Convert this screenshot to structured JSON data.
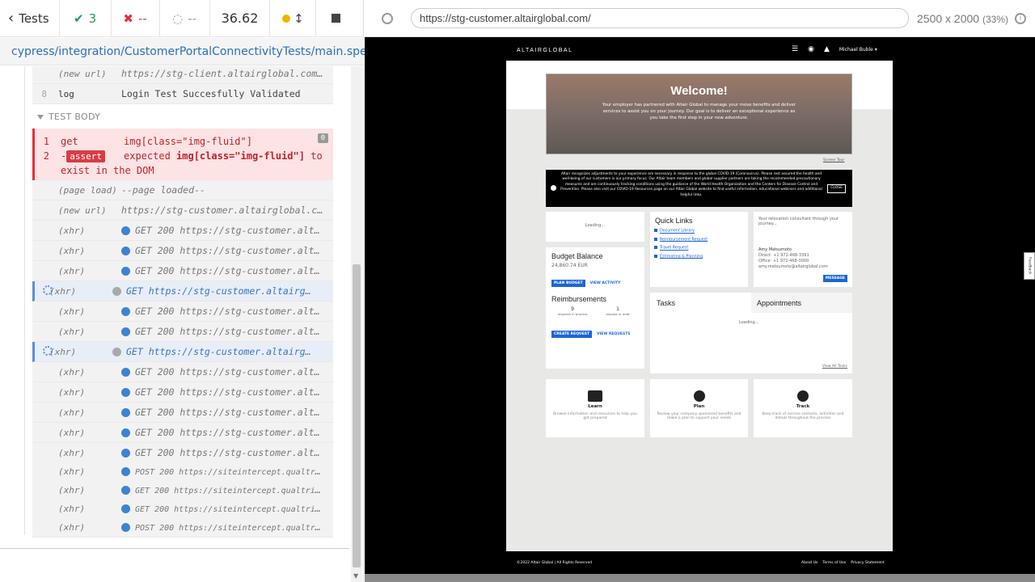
{
  "runner": {
    "tests_label": "Tests",
    "passed": "3",
    "failed": "--",
    "pending": "--",
    "duration": "36.62",
    "spec_path": "cypress/integration/CustomerPortalConnectivityTests/main.spec.js"
  },
  "reporter": {
    "pre_rows": [
      {
        "num": "",
        "name": "(new url)",
        "msg": "https://stg-client.altairglobal.com/a…"
      },
      {
        "num": "8",
        "name": "log",
        "msg": "Login Test Succesfully Validated"
      }
    ],
    "test_body_label": "TEST BODY",
    "fail": {
      "cmd1_num": "1",
      "cmd1_name": "get",
      "cmd1_msg": "img[class=\"img-fluid\"]",
      "badge": "0",
      "cmd2_num": "2",
      "cmd2_prefix": "-",
      "cmd2_name": "assert",
      "cmd2_msg_a": "expected",
      "cmd2_msg_b": "img[class=\"img-fluid\"]",
      "cmd2_msg_c": "to",
      "cmd2_msg_d": "exist in the DOM"
    },
    "rows": [
      {
        "name": "(page load)",
        "msg": "--page loaded--"
      },
      {
        "name": "(new url)",
        "msg": "https://stg-customer.altairglobal.com/"
      },
      {
        "name": "(xhr)",
        "msg": "GET 200 https://stg-customer.altai…"
      },
      {
        "name": "(xhr)",
        "msg": "GET 200 https://stg-customer.altai…"
      },
      {
        "name": "(xhr)",
        "msg": "GET 200 https://stg-customer.altai…"
      },
      {
        "name": "(xhr)",
        "msg": "GET https://stg-customer.altairglo…"
      },
      {
        "name": "(xhr)",
        "msg": "GET 200 https://stg-customer.altai…"
      },
      {
        "name": "(xhr)",
        "msg": "GET 200 https://stg-customer.altai…"
      },
      {
        "name": "(xhr)",
        "msg": "GET https://stg-customer.altairglo…"
      },
      {
        "name": "(xhr)",
        "msg": "GET 200 https://stg-customer.altai…"
      },
      {
        "name": "(xhr)",
        "msg": "GET 200 https://stg-customer.altai…"
      },
      {
        "name": "(xhr)",
        "msg": "GET 200 https://stg-customer.altai…"
      },
      {
        "name": "(xhr)",
        "msg": "GET 200 https://stg-customer.altai…"
      },
      {
        "name": "(xhr)",
        "msg": "GET 200 https://stg-customer.altai…"
      },
      {
        "name": "(xhr)",
        "msg": "POST 200 https://siteintercept.qualtrics.…"
      },
      {
        "name": "(xhr)",
        "msg": "GET 200 https://siteintercept.qualtrics.c…"
      },
      {
        "name": "(xhr)",
        "msg": "GET 200 https://siteintercept.qualtrics.c…"
      },
      {
        "name": "(xhr)",
        "msg": "POST 200 https://siteintercept.qualtrics.…"
      }
    ]
  },
  "browser": {
    "url": "https://stg-customer.altairglobal.com/",
    "viewport": "2500 x 2000",
    "zoom": "(33%)"
  },
  "app": {
    "brand": "ALTAIRGLOBAL",
    "user": "Michael Buble ▾",
    "welcome": "Welcome!",
    "welcome_text": "Your employer has partnered with Altair Global to manage your move benefits and deliver services to assist you on your journey. Our goal is to deliver an exceptional experience as you take the first step in your new adventure.",
    "screen_tour": "Screen Tour",
    "covid_text": "Altair recognizes adjustments to your experience are necessary in response to the global COVID-19 (Coronavirus). Please rest assured the health and well-being of our customers is our primary focus. Our Altair team members and global supplier partners are taking the recommended precautionary measures and are continuously tracking conditions using the guidance of the World Health Organization and the Centers for Disease Control and Prevention. Please also visit our COVID-19 Resources page on our Altair Global website to find useful information, educational webinars and additional helpful links.",
    "covid_close": "CLOSE",
    "loading": "Loading...",
    "quick_links": "Quick Links",
    "ql_items": [
      "Document Library",
      "Reimbursement Request",
      "Travel Request",
      "Estimating & Planning"
    ],
    "consultant_intro": "Your relocation consultant through your journey...",
    "consultant_name": "Amy Matsumoto",
    "consultant_direct": "Direct: +1 972-468-3391",
    "consultant_office": "Office: +1 972-468-3000",
    "consultant_email": "amy.matsumoto@altairglobal.com",
    "message_btn": "MESSAGE",
    "budget_title": "Budget Balance",
    "budget_amount": "24,860.74 EUR",
    "plan_budget": "PLAN BUDGET",
    "view_activity": "VIEW ACTIVITY",
    "reimb_title": "Reimbursements",
    "reimb_in_process": "9",
    "reimb_in_process_label": "requests in process",
    "reimb_in_draft": "1",
    "reimb_in_draft_label": "request in draft",
    "create_request": "CREATE REQUEST",
    "view_requests": "VIEW REQUESTS",
    "tasks": "Tasks",
    "appointments": "Appointments",
    "view_all_tasks": "View All Tasks",
    "tiles": [
      {
        "title": "Learn",
        "desc": "Browse information and resources to help you get prepared"
      },
      {
        "title": "Plan",
        "desc": "Review your company sponsored benefits and make a plan to support your needs"
      },
      {
        "title": "Track",
        "desc": "Keep track of service contacts, activities and details throughout the process"
      }
    ],
    "footer_copy": "©2022 Altair Global | All Rights Reserved",
    "footer_links": [
      "About Us",
      "Terms of Use",
      "Privacy Statement"
    ],
    "feedback": "Feedback"
  }
}
